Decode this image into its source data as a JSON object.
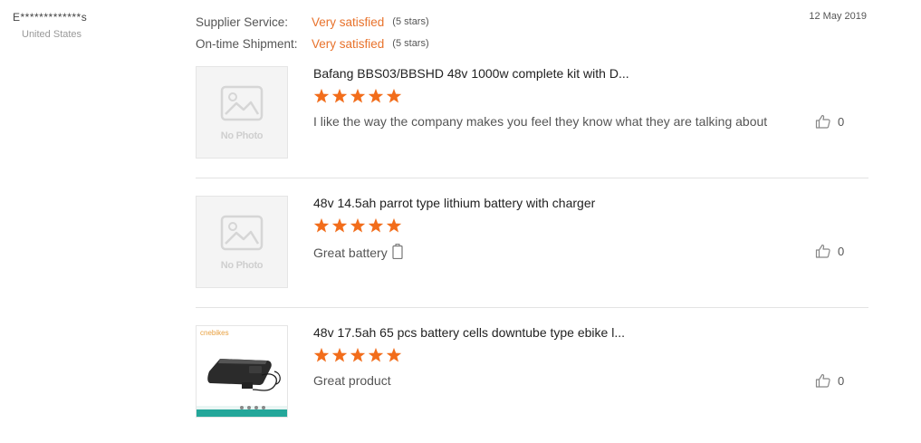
{
  "buyer": {
    "name": "E*************s",
    "country": "United States"
  },
  "ratings": [
    {
      "label": "Supplier Service:",
      "value": "Very satisfied",
      "stars": "(5 stars)"
    },
    {
      "label": "On-time Shipment:",
      "value": "Very satisfied",
      "stars": "(5 stars)"
    }
  ],
  "date": "12 May 2019",
  "reviews": [
    {
      "title": "Bafang BBS03/BBSHD 48v 1000w complete kit with D...",
      "rating": 5,
      "comment": "I like the way the company makes you feel they know what they are talking about",
      "likes": "0",
      "thumbnail": "No Photo"
    },
    {
      "title": "48v 14.5ah parrot type lithium battery with charger",
      "rating": 5,
      "comment": "Great battery",
      "likes": "0",
      "thumbnail": "No Photo"
    },
    {
      "title": "48v 17.5ah 65 pcs battery cells downtube type ebike l...",
      "rating": 5,
      "comment": "Great product",
      "likes": "0",
      "thumbnail_brand": "cnebikes"
    }
  ],
  "colors": {
    "accent": "#e8722b",
    "star": "#f26d1b"
  },
  "icons": {
    "like": "thumbs-up-icon",
    "placeholder": "image-placeholder-icon",
    "battery": "battery-icon"
  }
}
